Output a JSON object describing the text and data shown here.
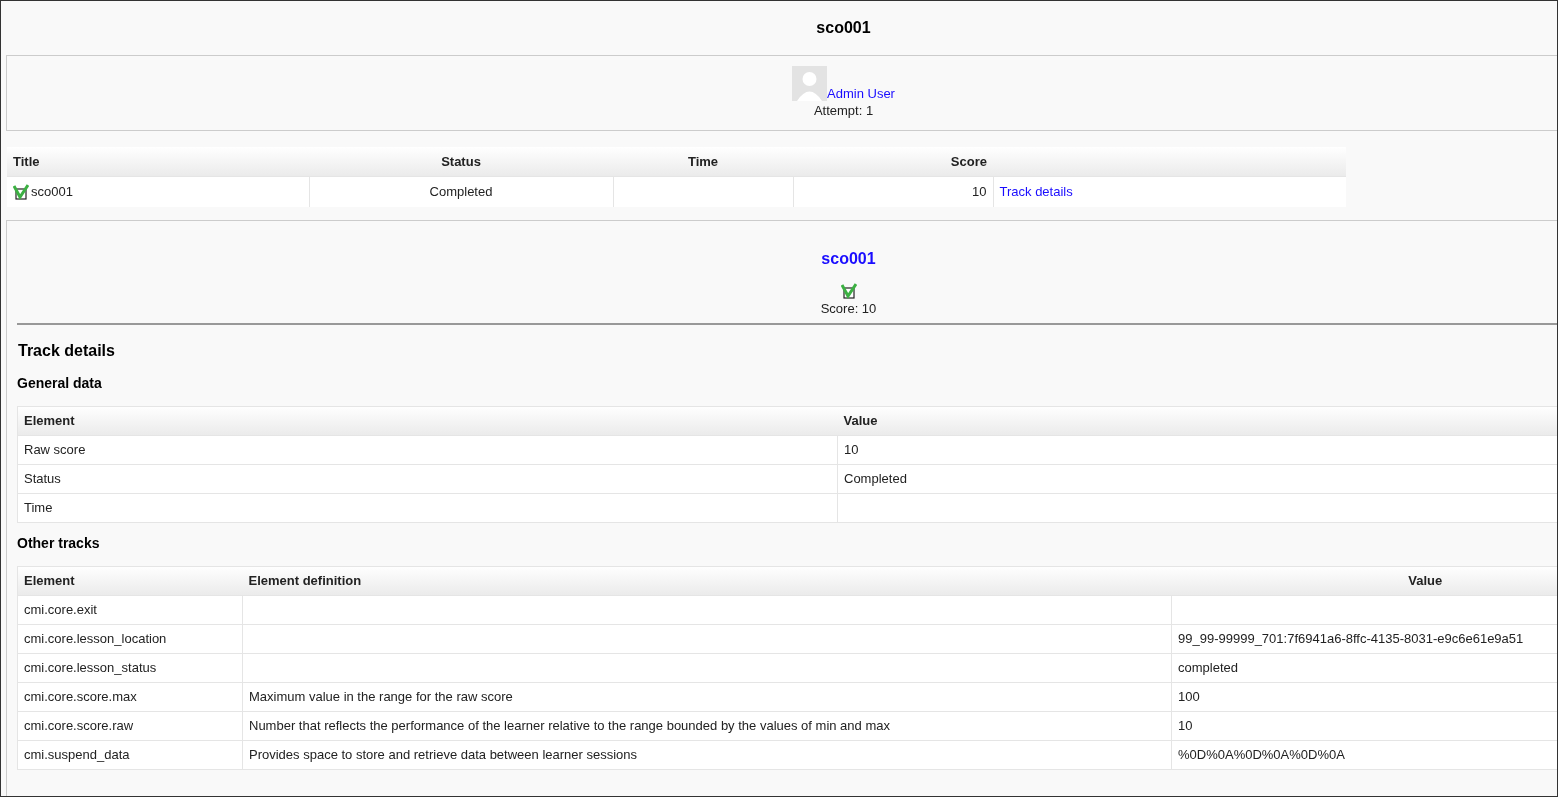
{
  "page_title": "sco001",
  "user": {
    "name": "Admin User",
    "attempt": "Attempt: 1"
  },
  "attempts_table": {
    "columns": [
      "Title",
      "Status",
      "Time",
      "Score"
    ],
    "rows": [
      {
        "title": "sco001",
        "completed": true,
        "status": "Completed",
        "time": "",
        "score": "10",
        "link": "Track details"
      }
    ]
  },
  "sco": {
    "title": "sco001",
    "completed": true,
    "score": "Score: 10"
  },
  "track_heading": "Track details",
  "general": {
    "heading": "General data",
    "columns": [
      "Element",
      "Value"
    ],
    "rows": [
      [
        "Raw score",
        "10"
      ],
      [
        "Status",
        "Completed"
      ],
      [
        "Time",
        ""
      ]
    ]
  },
  "other": {
    "heading": "Other tracks",
    "columns": [
      "Element",
      "Element definition",
      "Value"
    ],
    "rows": [
      [
        "cmi.core.exit",
        "",
        ""
      ],
      [
        "cmi.core.lesson_location",
        "",
        "99_99-99999_701:7f6941a6-8ffc-4135-8031-e9c6e61e9a51"
      ],
      [
        "cmi.core.lesson_status",
        "",
        "completed"
      ],
      [
        "cmi.core.score.max",
        "Maximum value in the range for the raw score",
        "100"
      ],
      [
        "cmi.core.score.raw",
        "Number that reflects the performance of the learner relative to the range bounded by the values of min and max",
        "10"
      ],
      [
        "cmi.suspend_data",
        "Provides space to store and retrieve data between learner sessions",
        "%0D%0A%0D%0A%0D%0A"
      ]
    ]
  }
}
